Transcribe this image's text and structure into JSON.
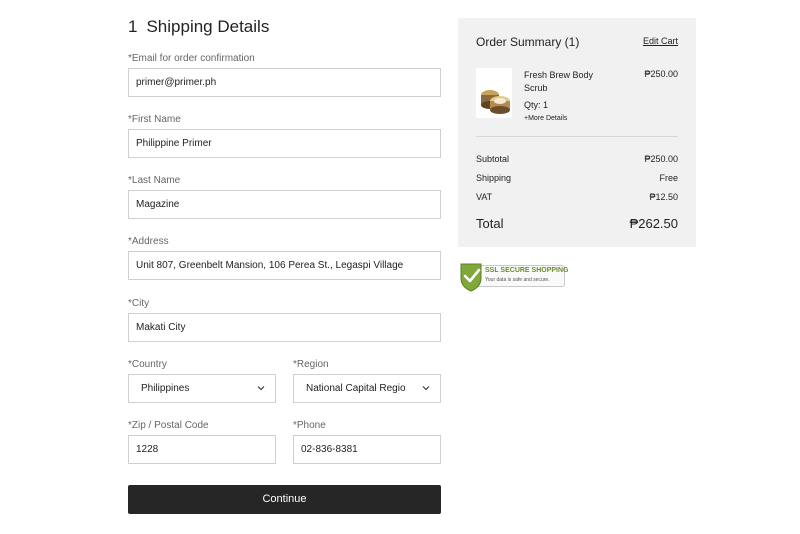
{
  "shipping": {
    "step_number": "1",
    "title": "Shipping Details",
    "email_label": "*Email for order confirmation",
    "email_value": "primer@primer.ph",
    "first_name_label": "*First Name",
    "first_name_value": "Philippine Primer",
    "last_name_label": "*Last Name",
    "last_name_value": "Magazine",
    "address_label": "*Address",
    "address_value": "Unit 807, Greenbelt Mansion, 106 Perea St., Legaspi Village",
    "city_label": "*City",
    "city_value": "Makati City",
    "country_label": "*Country",
    "country_value": "Philippines",
    "region_label": "*Region",
    "region_value": "National Capital Regio",
    "zip_label": "*Zip / Postal Code",
    "zip_value": "1228",
    "phone_label": "*Phone",
    "phone_value": "02-836-8381",
    "continue_label": "Continue"
  },
  "summary": {
    "title": "Order Summary (1)",
    "edit_cart": "Edit Cart",
    "item": {
      "name": "Fresh Brew Body Scrub",
      "price": "₱250.00",
      "qty": "Qty: 1",
      "more": "+More Details"
    },
    "subtotal_label": "Subtotal",
    "subtotal_value": "₱250.00",
    "shipping_label": "Shipping",
    "shipping_value": "Free",
    "vat_label": "VAT",
    "vat_value": "₱12.50",
    "total_label": "Total",
    "total_value": "₱262.50"
  },
  "ssl_badge": {
    "title": "SSL SECURE SHOPPING",
    "subtitle": "Your data is safe and secure."
  },
  "colors": {
    "button_bg": "#262626",
    "summary_bg": "#f1f1f1",
    "ssl_green": "#6a8e2a"
  }
}
